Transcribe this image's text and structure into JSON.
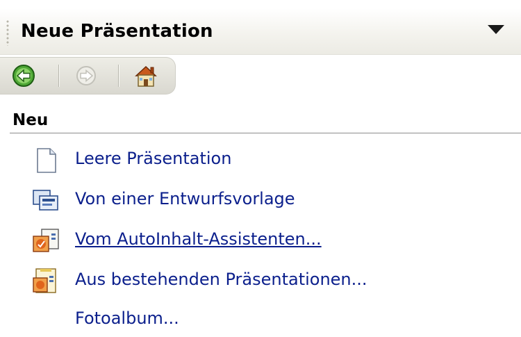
{
  "pane": {
    "title": "Neue Präsentation",
    "menu_icon": "dropdown-triangle-icon"
  },
  "nav": {
    "back_icon": "back-arrow-icon",
    "forward_icon": "forward-arrow-icon",
    "home_icon": "home-icon",
    "forward_enabled": false
  },
  "section": {
    "label": "Neu"
  },
  "items": [
    {
      "label": "Leere Präsentation",
      "icon": "blank-document-icon",
      "hovered": false
    },
    {
      "label": "Von einer Entwurfsvorlage",
      "icon": "design-template-icon",
      "hovered": false
    },
    {
      "label": "Vom AutoInhalt-Assistenten...",
      "icon": "autocontent-wizard-icon",
      "hovered": true
    },
    {
      "label": "Aus bestehenden Präsentationen...",
      "icon": "existing-presentation-icon",
      "hovered": false
    },
    {
      "label": "Fotoalbum...",
      "icon": "",
      "hovered": false
    }
  ],
  "colors": {
    "link": "#0b1f8c",
    "back_button": "#3b8f2a",
    "accent_orange": "#e0641c"
  }
}
